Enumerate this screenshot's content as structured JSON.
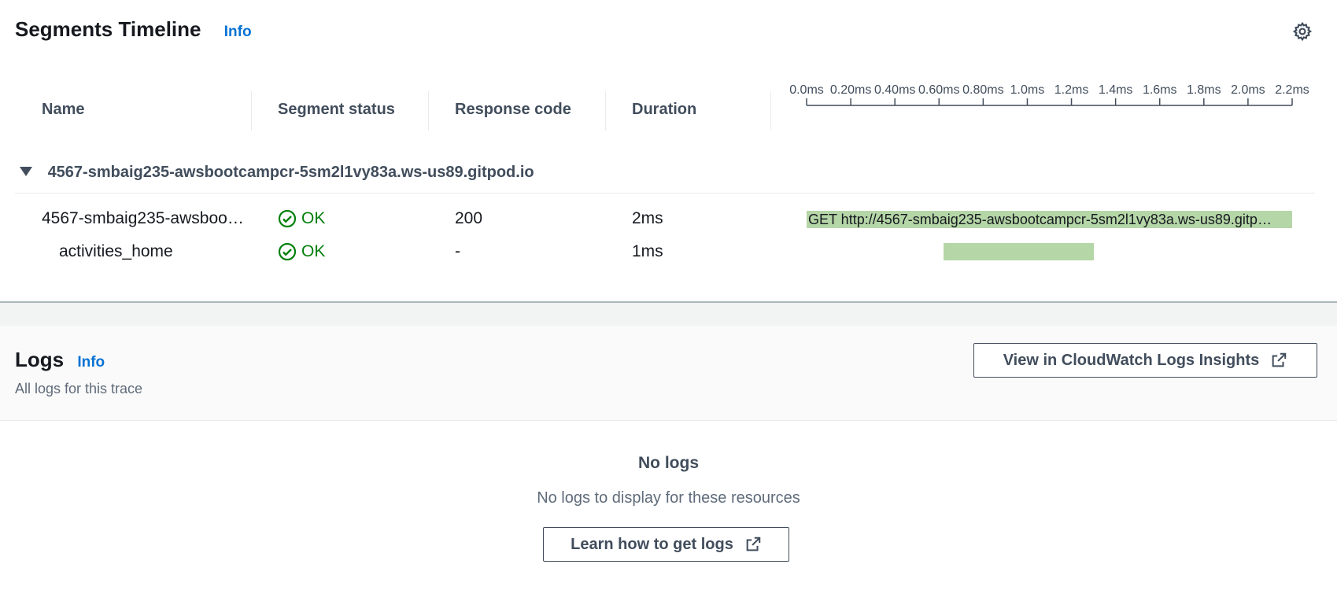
{
  "header": {
    "title": "Segments Timeline",
    "info": "Info"
  },
  "table": {
    "columns": [
      "Name",
      "Segment status",
      "Response code",
      "Duration"
    ],
    "timeline_ticks": [
      "0.0ms",
      "0.20ms",
      "0.40ms",
      "0.60ms",
      "0.80ms",
      "1.0ms",
      "1.2ms",
      "1.4ms",
      "1.6ms",
      "1.8ms",
      "2.0ms",
      "2.2ms"
    ],
    "group_label": "4567-smbaig235-awsbootcampcr-5sm2l1vy83a.ws-us89.gitpod.io",
    "rows": [
      {
        "name": "4567-smbaig235-awsboo…",
        "status": "OK",
        "code": "200",
        "duration": "2ms",
        "bar_label": "GET http://4567-smbaig235-awsbootcampcr-5sm2l1vy83a.ws-us89.gitp…",
        "start_ms": 0.0,
        "end_ms": 2.2
      },
      {
        "name": "activities_home",
        "status": "OK",
        "code": "-",
        "duration": "1ms",
        "bar_label": "",
        "start_ms": 0.62,
        "end_ms": 1.3
      }
    ]
  },
  "logs": {
    "title": "Logs",
    "info": "Info",
    "subtitle": "All logs for this trace",
    "cloudwatch_button": "View in CloudWatch Logs Insights",
    "empty_title": "No logs",
    "empty_message": "No logs to display for these resources",
    "learn_button": "Learn how to get logs"
  },
  "colors": {
    "accent": "#0972d3",
    "ok": "#037f0c",
    "bar": "#b5d6a7"
  },
  "icons": {
    "settings": "gear-icon",
    "expand": "caret-down-icon",
    "status_ok": "check-circle-icon",
    "external": "external-link-icon"
  }
}
